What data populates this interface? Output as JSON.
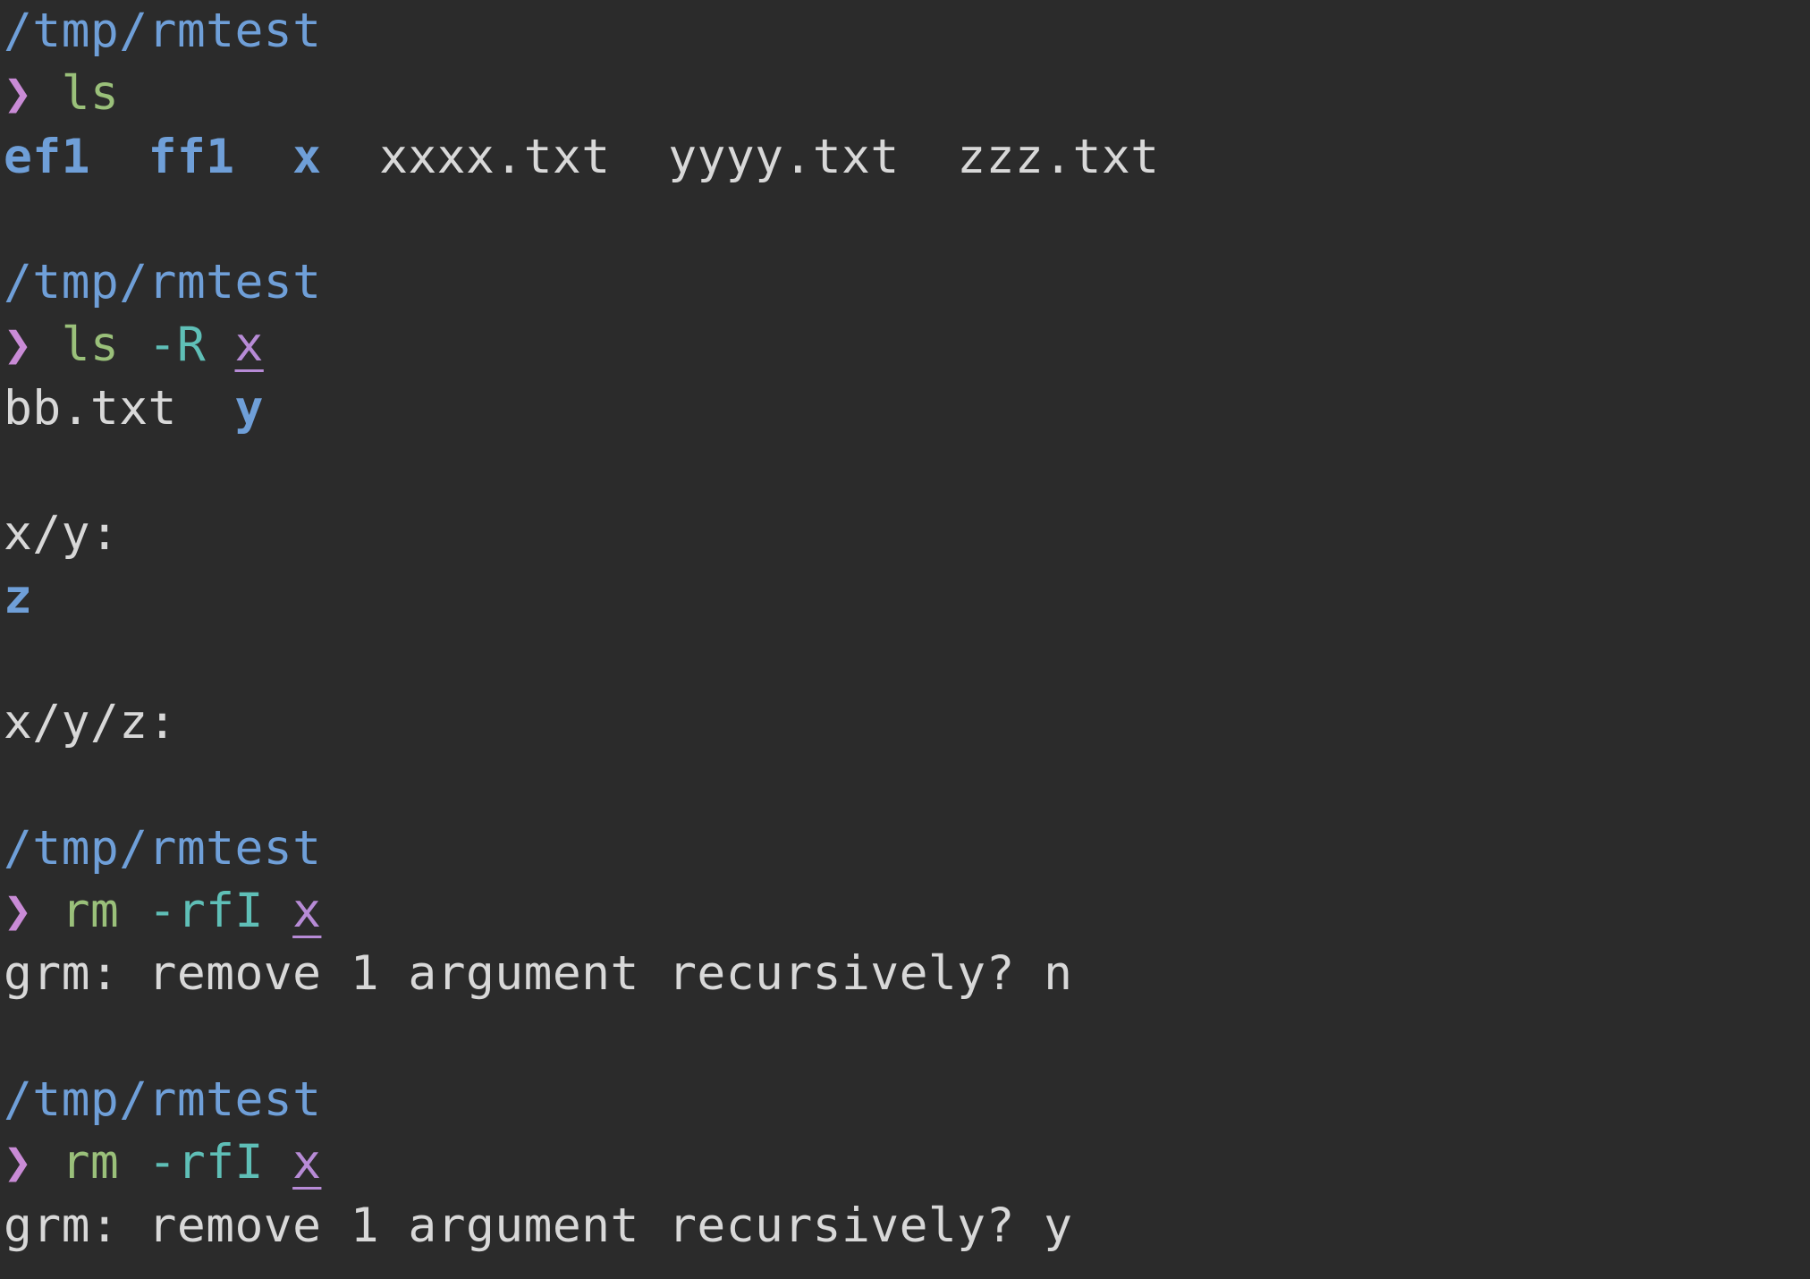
{
  "blocks": [
    {
      "path": "/tmp/rmtest",
      "prompt": "❯",
      "command": "ls",
      "output_line": {
        "dirs": [
          "ef1",
          "ff1",
          "x"
        ],
        "files": [
          "xxxx.txt",
          "yyyy.txt",
          "zzz.txt"
        ]
      }
    },
    {
      "path": "/tmp/rmtest",
      "prompt": "❯",
      "command": "ls",
      "flag": "-R",
      "arg": "x",
      "output": {
        "line1_file": "bb.txt",
        "line1_dir": "y",
        "header1": "x/y:",
        "header1_dir": "z",
        "header2": "x/y/z:"
      }
    },
    {
      "path": "/tmp/rmtest",
      "prompt": "❯",
      "command": "rm",
      "flag": "-rfI",
      "arg": "x",
      "output": "grm: remove 1 argument recursively? n"
    },
    {
      "path": "/tmp/rmtest",
      "prompt": "❯",
      "command": "rm",
      "flag": "-rfI",
      "arg": "x",
      "output": "grm: remove 1 argument recursively? y"
    }
  ],
  "colors": {
    "background": "#2b2b2b",
    "path": "#6f9fd8",
    "prompt": "#c98bd6",
    "command": "#9ac07a",
    "flag": "#5fbfb7",
    "argument": "#b78bd6",
    "directory": "#6f9fd8",
    "text": "#d8d8d8"
  }
}
